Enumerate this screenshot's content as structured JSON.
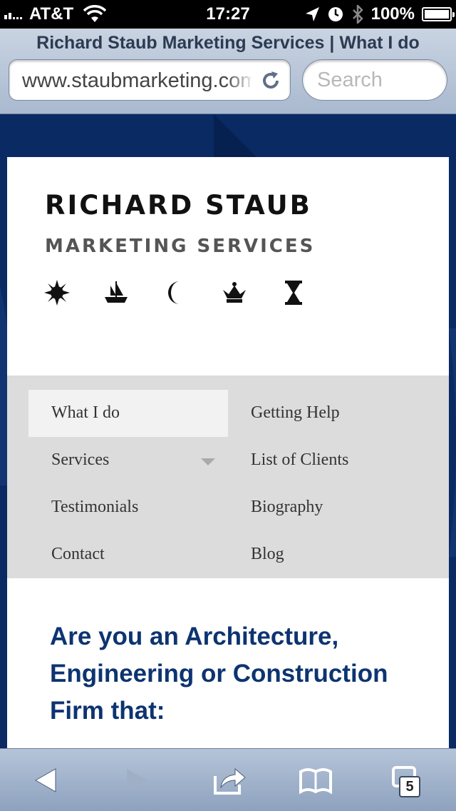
{
  "status_bar": {
    "carrier": "AT&T",
    "time": "17:27",
    "battery": "100%"
  },
  "browser": {
    "page_title": "Richard Staub Marketing Services | What I do",
    "url": "www.staubmarketing.com",
    "search_placeholder": "Search",
    "tab_count": "5"
  },
  "header": {
    "logo_line1": "RICHARD STAUB",
    "logo_line2": "MARKETING SERVICES",
    "emblems": [
      "sun-icon",
      "ship-icon",
      "moon-icon",
      "crown-icon",
      "hourglass-icon"
    ]
  },
  "nav": {
    "col1": [
      {
        "label": "What I do",
        "active": true
      },
      {
        "label": "Services",
        "has_dropdown": true
      },
      {
        "label": "Testimonials"
      },
      {
        "label": "Contact"
      }
    ],
    "col2": [
      {
        "label": "Getting Help"
      },
      {
        "label": "List of Clients"
      },
      {
        "label": "Biography"
      },
      {
        "label": "Blog"
      }
    ]
  },
  "main": {
    "headline": "Are you an Architecture, Engineering or Construction Firm that:"
  },
  "colors": {
    "page_background": "#0a2a63",
    "headline": "#0d3471",
    "menu_background": "#dcdcdc",
    "menu_active": "#f2f2f2"
  }
}
